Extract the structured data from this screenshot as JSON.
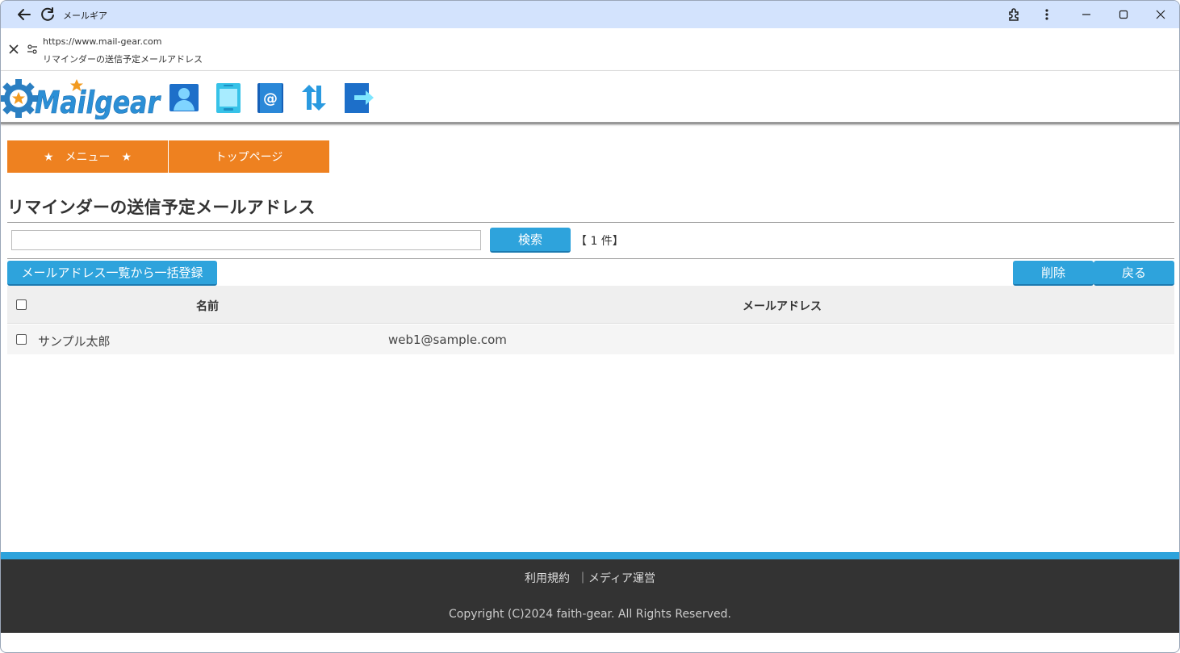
{
  "browser": {
    "tab_title": "メールギア",
    "url": "https://www.mail-gear.com",
    "page_title": "リマインダーの送信予定メールアドレス"
  },
  "header": {
    "logo_text": "Mailgear",
    "icons": [
      "user-icon",
      "tablet-icon",
      "address-book-icon",
      "sync-icon",
      "logout-icon"
    ]
  },
  "menu": {
    "menu_label": "★　メニュー　★",
    "top_label": "トップページ"
  },
  "main": {
    "title": "リマインダーの送信予定メールアドレス",
    "search": {
      "value": "",
      "button_label": "検索"
    },
    "count_label": "【 1 件】",
    "bulk_register_label": "メールアドレス一覧から一括登録",
    "delete_label": "削除",
    "back_label": "戻る",
    "table": {
      "headers": {
        "name": "名前",
        "email": "メールアドレス"
      },
      "rows": [
        {
          "name": "サンプル太郎",
          "email": "web1@sample.com"
        }
      ]
    }
  },
  "footer": {
    "links": [
      "利用規約",
      "メディア運営"
    ],
    "separator": "｜",
    "copyright": "Copyright (C)2024 faith-gear. All Rights Reserved."
  },
  "colors": {
    "accent_orange": "#ee8120",
    "accent_blue": "#2ea3dc",
    "footer_bg": "#333333"
  }
}
